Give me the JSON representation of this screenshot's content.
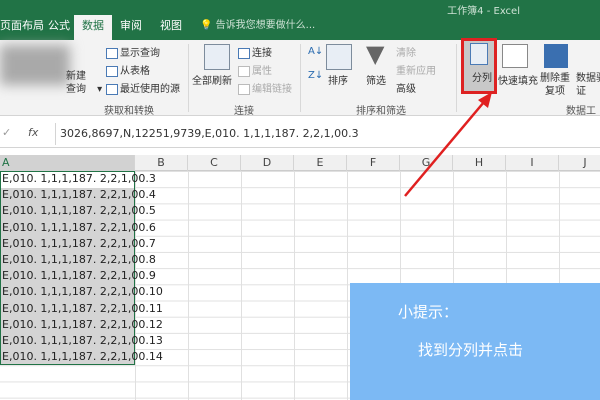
{
  "window_title": "工作簿4 - Excel",
  "tabs": [
    {
      "label": "页面布局"
    },
    {
      "label": "公式"
    },
    {
      "label": "数据",
      "active": true
    },
    {
      "label": "审阅"
    },
    {
      "label": "视图"
    }
  ],
  "tell_me": "告诉我您想要做什么...",
  "ribbon": {
    "new_query": "新建查询",
    "show_query": "显示查询",
    "from_table": "从表格",
    "recent_sources": "最近使用的源",
    "group_get": "获取和转换",
    "refresh_all": "全部刷新",
    "connections": "连接",
    "properties": "属性",
    "edit_links": "编辑链接",
    "group_connections": "连接",
    "sort": "排序",
    "filter": "筛选",
    "clear": "清除",
    "reapply": "重新应用",
    "advanced": "高级",
    "group_sort": "排序和筛选",
    "text_to_columns": "分列",
    "flash_fill": "快速填充",
    "remove_dup": "删除重复项",
    "data_validation": "数据验证",
    "group_tools": "数据工具"
  },
  "formula_bar": {
    "fx": "fx",
    "value": "3026,8697,N,12251,9739,E,010. 1,1,1,187. 2,2,1,00.3"
  },
  "columns": [
    "A",
    "B",
    "C",
    "D",
    "E",
    "F",
    "G",
    "H",
    "I",
    "J"
  ],
  "cells": [
    "E,010. 1,1,1,187. 2,2,1,00.3",
    "E,010. 1,1,1,187. 2,2,1,00.4",
    "E,010. 1,1,1,187. 2,2,1,00.5",
    "E,010. 1,1,1,187. 2,2,1,00.6",
    "E,010. 1,1,1,187. 2,2,1,00.7",
    "E,010. 1,1,1,187. 2,2,1,00.8",
    "E,010. 1,1,1,187. 2,2,1,00.9",
    "E,010. 1,1,1,187. 2,2,1,00.10",
    "E,010. 1,1,1,187. 2,2,1,00.11",
    "E,010. 1,1,1,187. 2,2,1,00.12",
    "E,010. 1,1,1,187. 2,2,1,00.13",
    "E,010. 1,1,1,187. 2,2,1,00.14"
  ],
  "tip": {
    "title": "小提示：",
    "body": "找到分列并点击"
  }
}
